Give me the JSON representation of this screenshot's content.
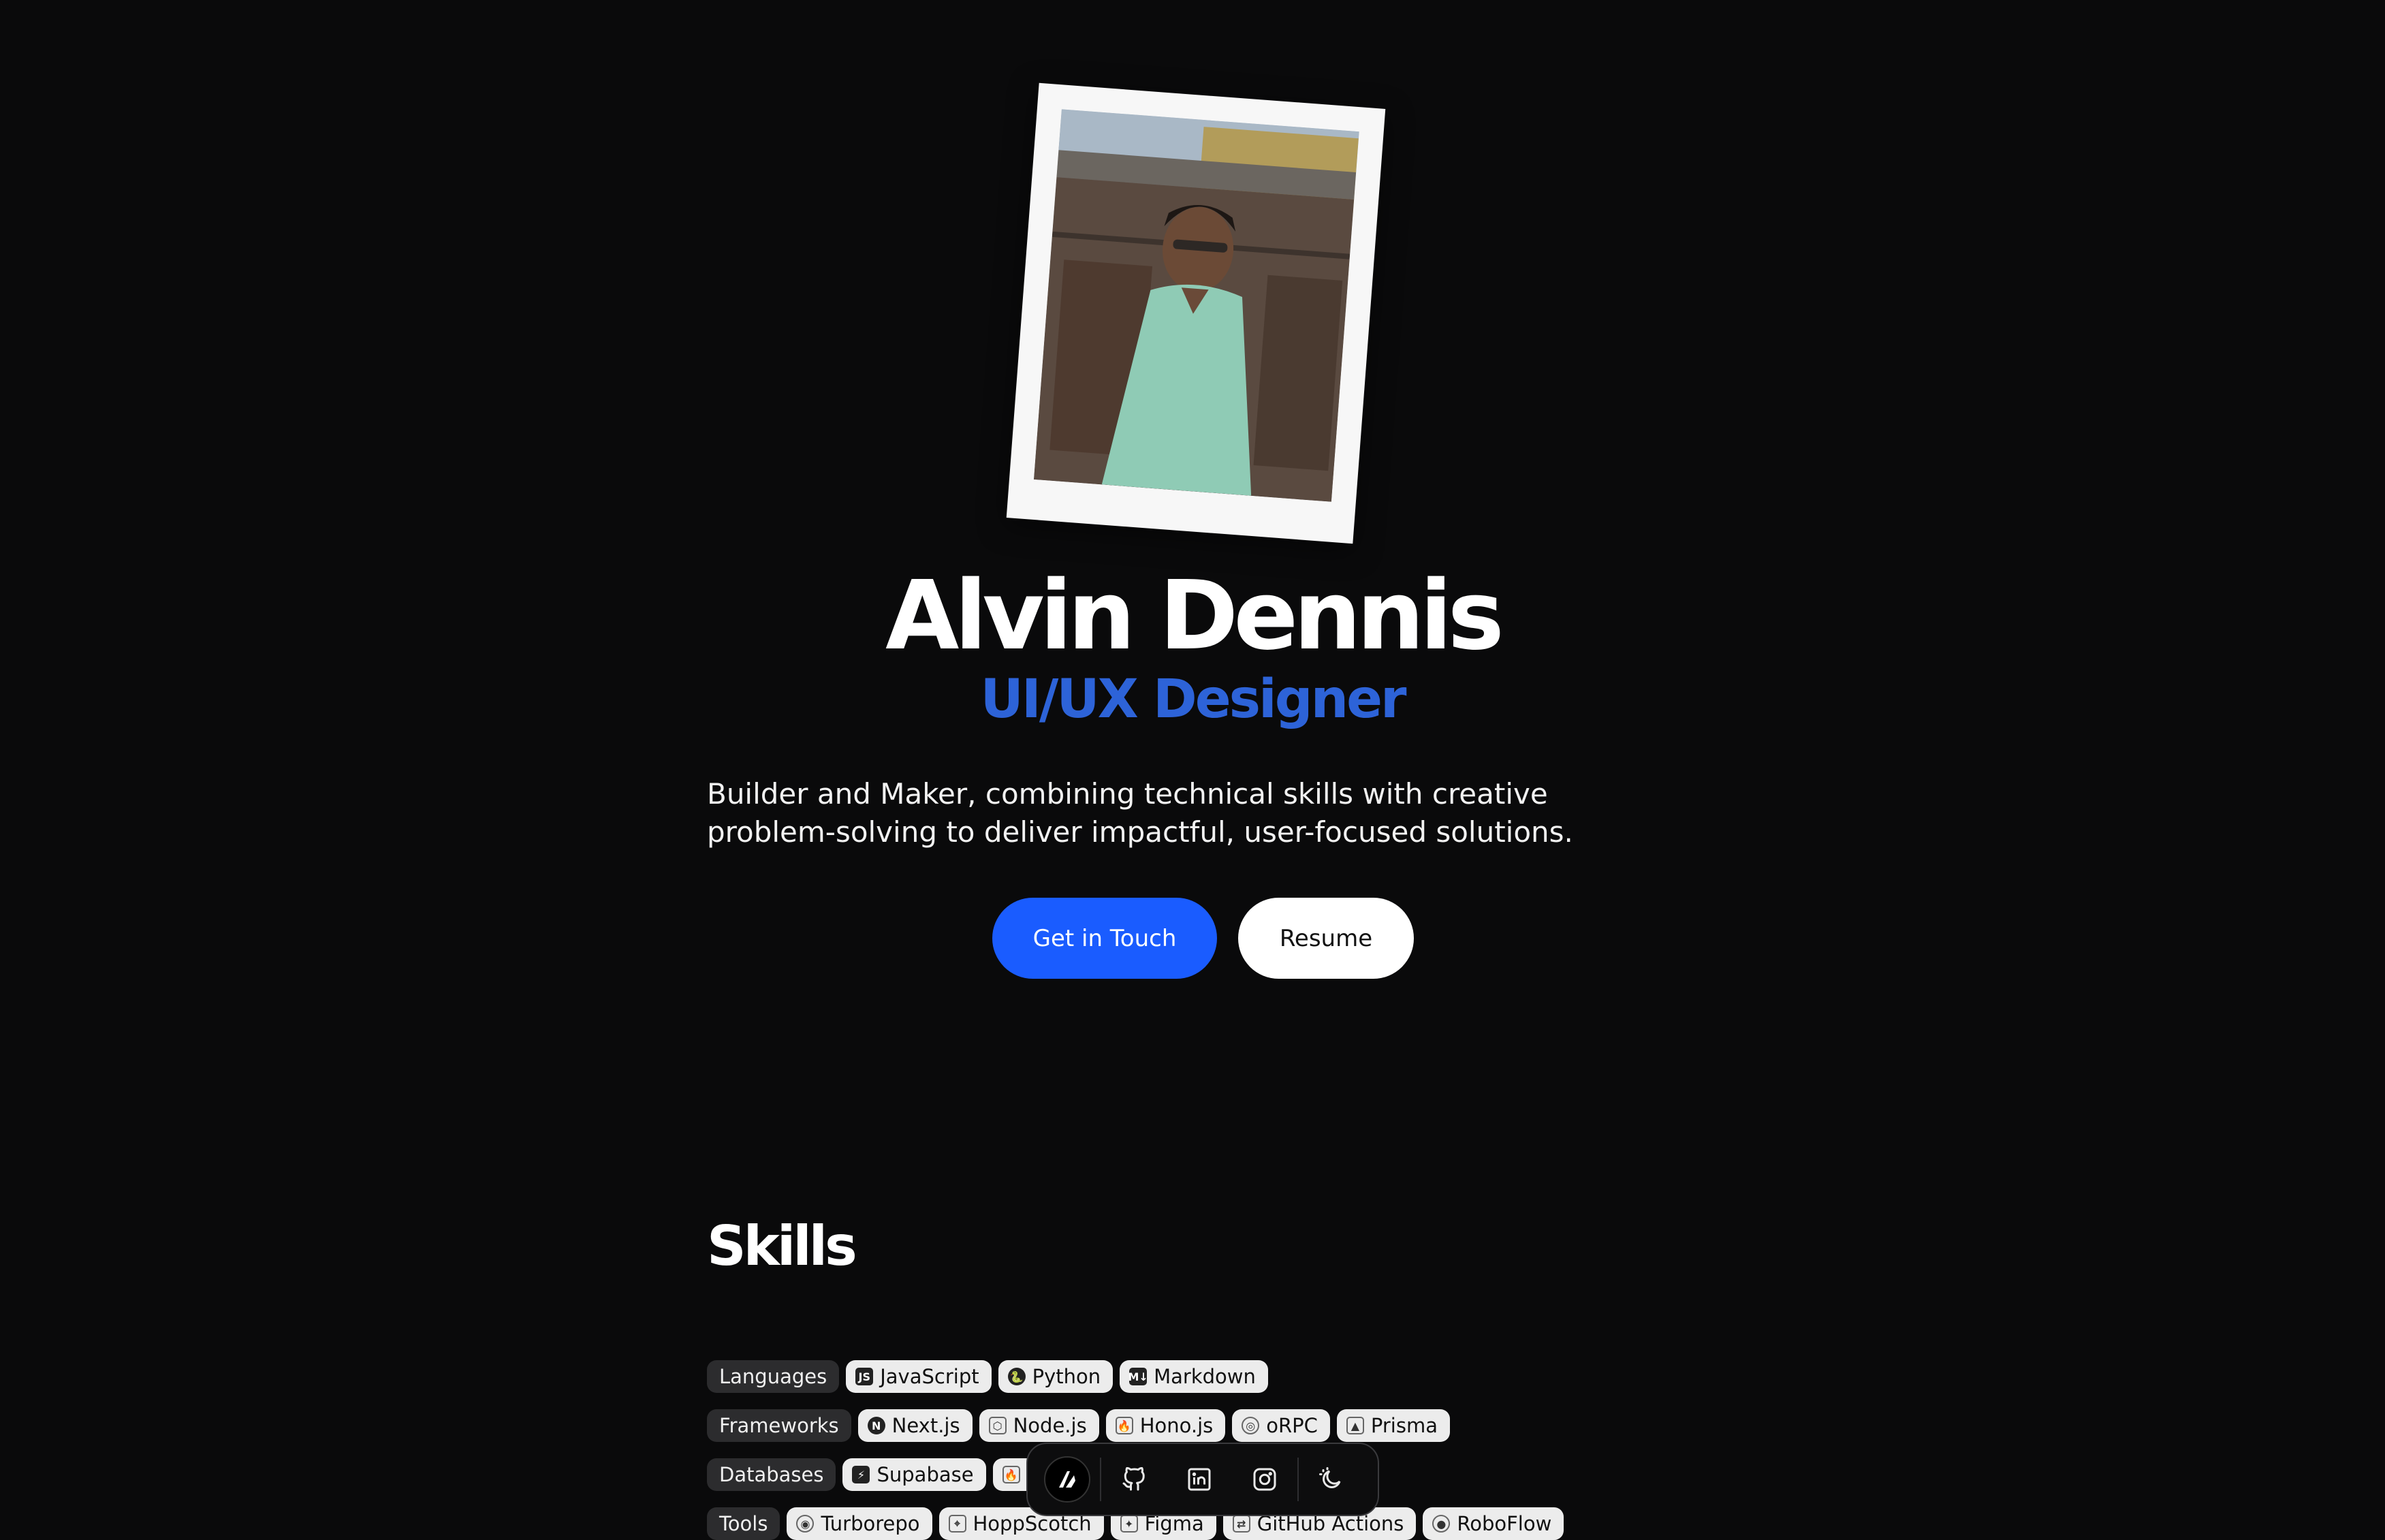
{
  "profile": {
    "name": "Alvin Dennis",
    "role": "UI/UX Designer",
    "bio": "Builder and Maker, combining technical skills with creative problem-solving to deliver impactful, user-focused solutions.",
    "photo_alt": "Portrait photo in polaroid frame"
  },
  "actions": {
    "primary_label": "Get in Touch",
    "secondary_label": "Resume"
  },
  "skills": {
    "title": "Skills",
    "rows": [
      {
        "category": "Languages",
        "items": [
          {
            "label": "JavaScript",
            "icon": "javascript-icon"
          },
          {
            "label": "Python",
            "icon": "python-icon"
          },
          {
            "label": "Markdown",
            "icon": "markdown-icon"
          }
        ]
      },
      {
        "category": "Frameworks",
        "items": [
          {
            "label": "Next.js",
            "icon": "nextjs-icon"
          },
          {
            "label": "Node.js",
            "icon": "nodejs-icon"
          },
          {
            "label": "Hono.js",
            "icon": "honojs-icon"
          },
          {
            "label": "oRPC",
            "icon": "orpc-icon"
          },
          {
            "label": "Prisma",
            "icon": "prisma-icon"
          }
        ]
      },
      {
        "category": "Databases",
        "items": [
          {
            "label": "Supabase",
            "icon": "supabase-icon"
          },
          {
            "label": "",
            "icon": "database-icon"
          }
        ]
      },
      {
        "category": "Tools",
        "items": [
          {
            "label": "Turborepo",
            "icon": "turborepo-icon"
          },
          {
            "label": "HoppScotch",
            "icon": "hoppscotch-icon"
          },
          {
            "label": "Figma",
            "icon": "figma-icon"
          },
          {
            "label": "GitHub Actions",
            "icon": "github-actions-icon"
          },
          {
            "label": "RoboFlow",
            "icon": "roboflow-icon"
          }
        ]
      }
    ]
  },
  "dock": {
    "items": [
      "home-logo-icon",
      "github-icon",
      "linkedin-icon",
      "instagram-icon",
      "theme-toggle-icon"
    ]
  },
  "colors": {
    "background": "#0a0a0b",
    "accent": "#1a5cff",
    "role_text": "#2d63d8"
  }
}
